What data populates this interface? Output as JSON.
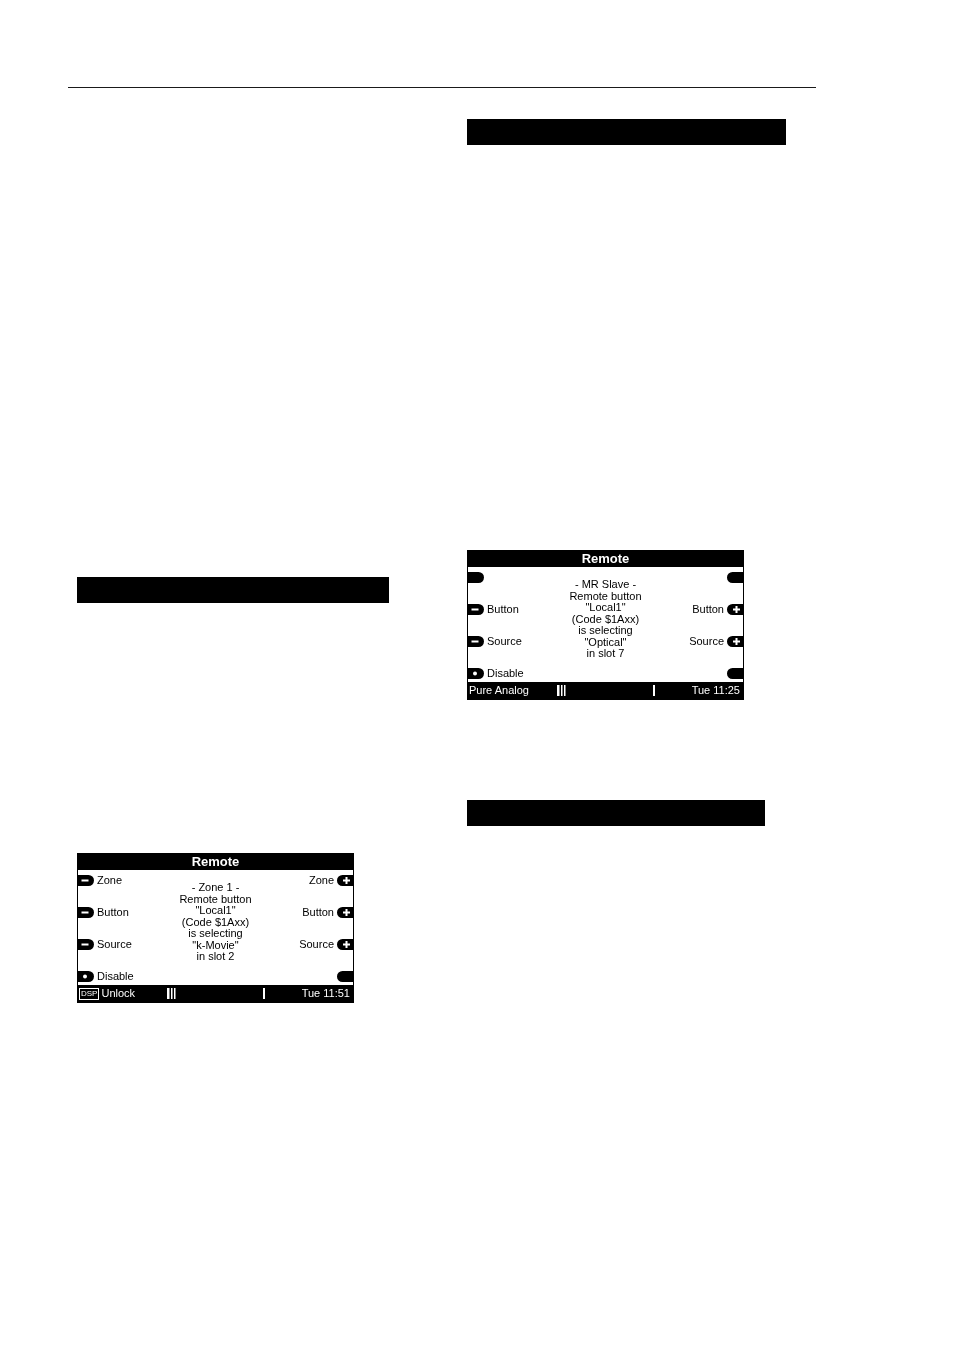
{
  "columns": [
    {
      "items": [
        {
          "kind": "heading_bar"
        },
        {
          "kind": "display",
          "title": "Remote",
          "left_keys": [
            {
              "kind": "minus",
              "label": "Zone"
            },
            {
              "kind": "minus",
              "label": "Button"
            },
            {
              "kind": "minus",
              "label": "Source"
            },
            {
              "kind": "dot",
              "label": "Disable"
            }
          ],
          "right_keys": [
            {
              "kind": "plus",
              "label": "Zone"
            },
            {
              "kind": "plus",
              "label": "Button"
            },
            {
              "kind": "plus",
              "label": "Source"
            },
            {
              "kind": "blank"
            }
          ],
          "message": "- Zone 1 -\nRemote button\n\"Local1\"\n(Code $1Axx)\nis selecting\n\"k-Movie\"\nin slot 2",
          "footer": {
            "badge": "DSP",
            "mode": "Unlock",
            "time": "Tue 11:51"
          }
        }
      ]
    },
    {
      "items": [
        {
          "kind": "heading_bar"
        },
        {
          "kind": "display",
          "title": "Remote",
          "left_keys": [
            {
              "kind": "blank"
            },
            {
              "kind": "minus",
              "label": "Button"
            },
            {
              "kind": "minus",
              "label": "Source"
            },
            {
              "kind": "dot",
              "label": "Disable"
            }
          ],
          "right_keys": [
            {
              "kind": "blank"
            },
            {
              "kind": "plus",
              "label": "Button"
            },
            {
              "kind": "plus",
              "label": "Source"
            },
            {
              "kind": "blank"
            }
          ],
          "message": "- MR Slave -\nRemote button\n\"Local1\"\n(Code $1Axx)\nis selecting\n\"Optical\"\nin slot 7",
          "footer": {
            "mode": "Pure Analog",
            "time": "Tue 11:25"
          }
        },
        {
          "kind": "heading_bar"
        }
      ]
    }
  ]
}
